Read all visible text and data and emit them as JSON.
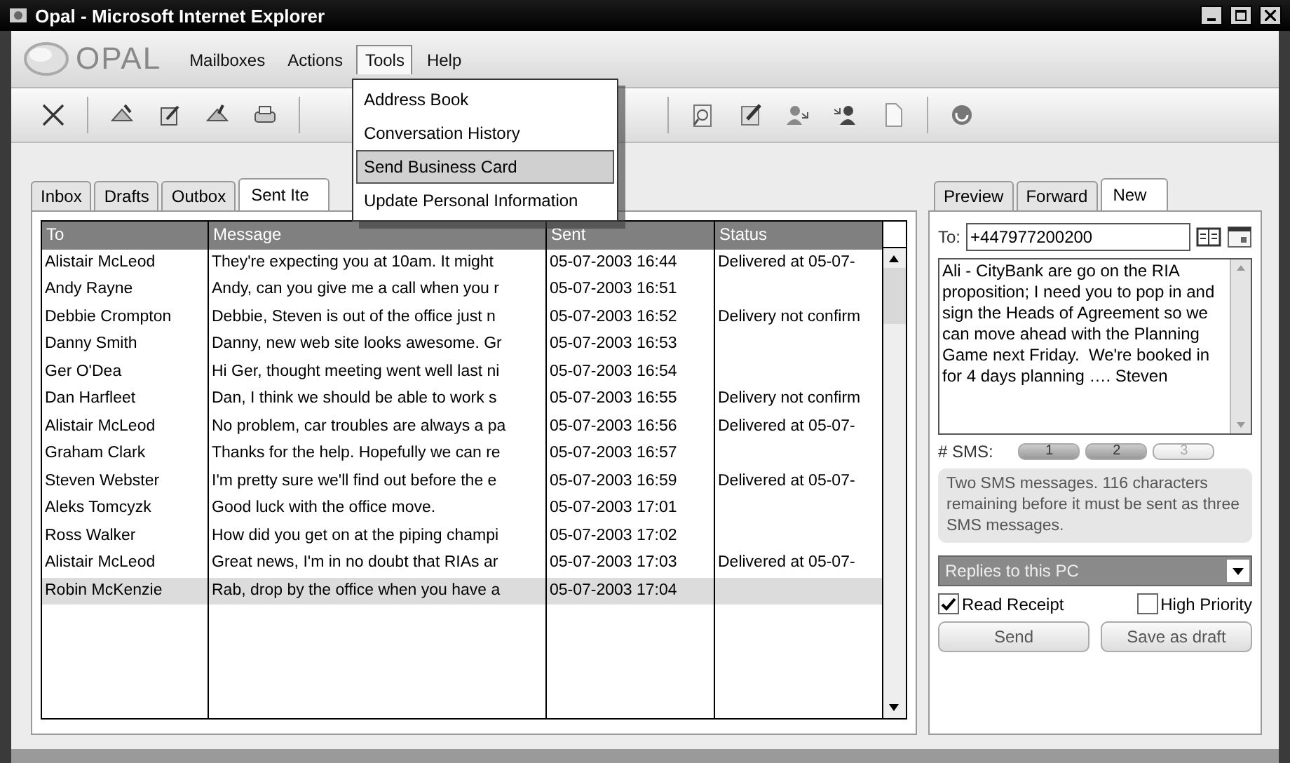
{
  "window": {
    "title": "Opal - Microsoft Internet Explorer"
  },
  "app": {
    "logo": "OPAL"
  },
  "menu": [
    {
      "label": "Mailboxes",
      "open": false
    },
    {
      "label": "Actions",
      "open": false
    },
    {
      "label": "Tools",
      "open": true
    },
    {
      "label": "Help",
      "open": false
    }
  ],
  "tools_menu": {
    "items": [
      {
        "label": "Address Book",
        "selected": false
      },
      {
        "label": "Conversation History",
        "selected": false
      },
      {
        "label": "Send Business Card",
        "selected": true
      },
      {
        "label": "Update Personal Information",
        "selected": false
      }
    ]
  },
  "folder_tabs": [
    {
      "label": "Inbox",
      "selected": false
    },
    {
      "label": "Drafts",
      "selected": false
    },
    {
      "label": "Outbox",
      "selected": false
    },
    {
      "label": "Sent Ite",
      "selected": true
    }
  ],
  "table": {
    "columns": [
      "To",
      "Message",
      "Sent",
      "Status"
    ],
    "rows": [
      {
        "to": "Alistair McLeod",
        "message": "They're expecting you at 10am. It might",
        "sent": "05-07-2003 16:44",
        "status": "Delivered at 05-07-",
        "selected": false
      },
      {
        "to": "Andy Rayne",
        "message": "Andy, can you give me a call when you r",
        "sent": "05-07-2003 16:51",
        "status": "",
        "selected": false
      },
      {
        "to": "Debbie Crompton",
        "message": "Debbie, Steven is out of the office just n",
        "sent": "05-07-2003 16:52",
        "status": "Delivery not confirm",
        "selected": false
      },
      {
        "to": "Danny Smith",
        "message": "Danny, new web site looks awesome. Gr",
        "sent": "05-07-2003 16:53",
        "status": "",
        "selected": false
      },
      {
        "to": "Ger O'Dea",
        "message": "Hi Ger, thought meeting went well last ni",
        "sent": "05-07-2003 16:54",
        "status": "",
        "selected": false
      },
      {
        "to": "Dan Harfleet",
        "message": "Dan, I think we should be able to work s",
        "sent": "05-07-2003 16:55",
        "status": "Delivery not confirm",
        "selected": false
      },
      {
        "to": "Alistair McLeod",
        "message": "No problem, car troubles are always a pa",
        "sent": "05-07-2003 16:56",
        "status": "Delivered at 05-07-",
        "selected": false
      },
      {
        "to": "Graham Clark",
        "message": "Thanks for the help. Hopefully we can re",
        "sent": "05-07-2003 16:57",
        "status": "",
        "selected": false
      },
      {
        "to": "Steven Webster",
        "message": "I'm pretty sure we'll find out before the e",
        "sent": "05-07-2003 16:59",
        "status": "Delivered at 05-07-",
        "selected": false
      },
      {
        "to": "Aleks Tomcyzk",
        "message": "Good luck with the office move.",
        "sent": "05-07-2003 17:01",
        "status": "",
        "selected": false
      },
      {
        "to": "Ross Walker",
        "message": "How did you get on at the piping champi",
        "sent": "05-07-2003 17:02",
        "status": "",
        "selected": false
      },
      {
        "to": "Alistair McLeod",
        "message": "Great news, I'm in no doubt that RIAs ar",
        "sent": "05-07-2003 17:03",
        "status": "Delivered at 05-07-",
        "selected": false
      },
      {
        "to": "Robin McKenzie",
        "message": "Rab, drop by the office when you have a",
        "sent": "05-07-2003 17:04",
        "status": "",
        "selected": true
      }
    ]
  },
  "compose": {
    "tabs": [
      {
        "label": "Preview",
        "selected": false
      },
      {
        "label": "Forward",
        "selected": false
      },
      {
        "label": "New",
        "selected": true
      }
    ],
    "to_label": "To:",
    "to_value": "+447977200200",
    "body": "Ali - CityBank are go on the RIA proposition; I need you to pop in and sign the Heads of Agreement so we can move ahead with the Planning Game next Friday.  We're booked in for 4 days planning …. Steven",
    "sms_label": "# SMS:",
    "sms_segments": [
      {
        "label": "1",
        "active": true
      },
      {
        "label": "2",
        "active": true
      },
      {
        "label": "3",
        "active": false
      }
    ],
    "info": "Two SMS messages. 116 characters remaining before it must be sent as three SMS messages.",
    "reply_option": "Replies to this PC",
    "options": [
      {
        "label": "Read Receipt",
        "checked": true
      },
      {
        "label": "High Priority",
        "checked": false
      }
    ],
    "buttons": [
      "Send",
      "Save as draft"
    ]
  }
}
